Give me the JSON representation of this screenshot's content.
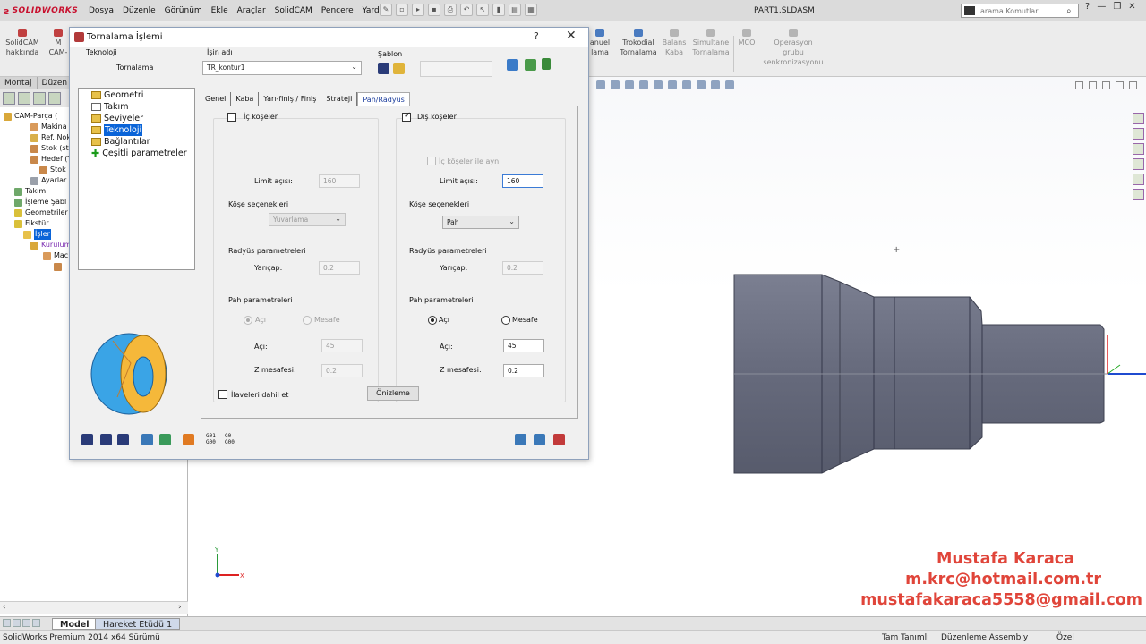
{
  "app": {
    "brand": "SOLIDWORKS",
    "menus": [
      "Dosya",
      "Düzenle",
      "Görünüm",
      "Ekle",
      "Araçlar",
      "SolidCAM",
      "Pencere",
      "Yardım"
    ],
    "document_title": "PART1.SLDASM",
    "search_placeholder": "arama Komutları"
  },
  "ribbon": {
    "items": [
      {
        "label": "SolidCAM\nhakkında",
        "icon": "solidcam-icon"
      },
      {
        "label": "M\nCAM-",
        "icon": "cam-icon"
      },
      {
        "label": "anuel\nlama",
        "icon": "manual-icon"
      },
      {
        "label": "Trokodial\nTornalama",
        "icon": "trochoidal-icon"
      },
      {
        "label": "Balans\nKaba",
        "icon": "balance-icon"
      },
      {
        "label": "Simultane\nTornalama",
        "icon": "simultaneous-icon"
      },
      {
        "label": "MCO",
        "icon": "mco-icon"
      },
      {
        "label": "Operasyon\ngrubu\nsenkronizasyonu",
        "icon": "sync-icon"
      }
    ]
  },
  "left_panel": {
    "tabs": [
      "Montaj",
      "Düzen"
    ],
    "tree": [
      {
        "label": "CAM-Parça (",
        "icon": "part-icon"
      },
      {
        "label": "Makina (",
        "icon": "machine-icon"
      },
      {
        "label": "Ref. Nok",
        "icon": "ref-point-icon"
      },
      {
        "label": "Stok (sto",
        "icon": "stock-icon"
      },
      {
        "label": "Hedef (T",
        "icon": "target-icon"
      },
      {
        "label": "Stok",
        "icon": "stock-icon"
      },
      {
        "label": "Ayarlar",
        "icon": "settings-icon"
      },
      {
        "label": "Takım",
        "icon": "tool-icon"
      },
      {
        "label": "İşleme Şabl",
        "icon": "template-icon"
      },
      {
        "label": "Geometriler",
        "icon": "geometry-icon"
      },
      {
        "label": "Fikstür",
        "icon": "fixture-icon"
      },
      {
        "label": "İşler",
        "icon": "operations-icon",
        "selected": true
      },
      {
        "label": "Kurulum",
        "icon": "setup-icon"
      },
      {
        "label": "Mac",
        "icon": "machine-icon"
      },
      {
        "label": "",
        "icon": "tool-icon"
      }
    ]
  },
  "bottom_tabs": [
    "Model",
    "Hareket Etüdü 1"
  ],
  "status": {
    "left": "SolidWorks Premium 2014 x64 Sürümü",
    "mid1": "Tam Tanımlı",
    "mid2": "Düzenleme Assembly",
    "right": "Özel"
  },
  "credits": {
    "name": "Mustafa Karaca",
    "email1": "m.krc@hotmail.com.tr",
    "email2": "mustafakaraca5558@gmail.com"
  },
  "colors": {
    "accent": "#0a64d8",
    "part": "#6a6e7f",
    "credits": "#e0453a"
  },
  "dialog": {
    "title": "Tornalama İşlemi",
    "help": "?",
    "close": "✕",
    "technology_label": "Teknoloji",
    "technology_value": "Tornalama",
    "job_name_label": "İşin adı",
    "job_name_value": "TR_kontur1",
    "template_label": "Şablon",
    "tree": [
      {
        "label": "Geometri"
      },
      {
        "label": "Takım"
      },
      {
        "label": "Seviyeler"
      },
      {
        "label": "Teknoloji",
        "selected": true
      },
      {
        "label": "Bağlantılar"
      },
      {
        "label": "Çeşitli parametreler"
      }
    ],
    "tabs": [
      "Genel",
      "Kaba",
      "Yarı-finiş / Finiş",
      "Strateji",
      "Pah/Radyüs"
    ],
    "active_tab": "Pah/Radyüs",
    "inner": {
      "title": "İç köşeler",
      "checked": false,
      "limit_label": "Limit açısı:",
      "limit_value": "160",
      "corner_options_label": "Köşe seçenekleri",
      "corner_option": "Yuvarlama",
      "radius_params_label": "Radyüs parametreleri",
      "radius_label": "Yarıçap:",
      "radius_value": "0.2",
      "chamfer_params_label": "Pah parametreleri",
      "angle_radio": "Açı",
      "distance_radio": "Mesafe",
      "angle_label": "Açı:",
      "angle_value": "45",
      "z_label": "Z mesafesi:",
      "z_value": "0.2"
    },
    "outer": {
      "title": "Dış köşeler",
      "checked": true,
      "same_as_inner": "İç köşeler ile aynı",
      "limit_label": "Limit açısı:",
      "limit_value": "160",
      "corner_options_label": "Köşe seçenekleri",
      "corner_option": "Pah",
      "radius_params_label": "Radyüs parametreleri",
      "radius_label": "Yarıçap:",
      "radius_value": "0.2",
      "chamfer_params_label": "Pah parametreleri",
      "angle_radio": "Açı",
      "distance_radio": "Mesafe",
      "angle_label": "Açı:",
      "angle_value": "45",
      "z_label": "Z mesafesi:",
      "z_value": "0.2"
    },
    "include_extensions": "İlaveleri dahil et",
    "preview_button": "Önizleme",
    "gcode_labels": [
      "G01\nG00",
      "G0\nG00"
    ]
  },
  "axes": {
    "x": "X",
    "y": "Y"
  }
}
